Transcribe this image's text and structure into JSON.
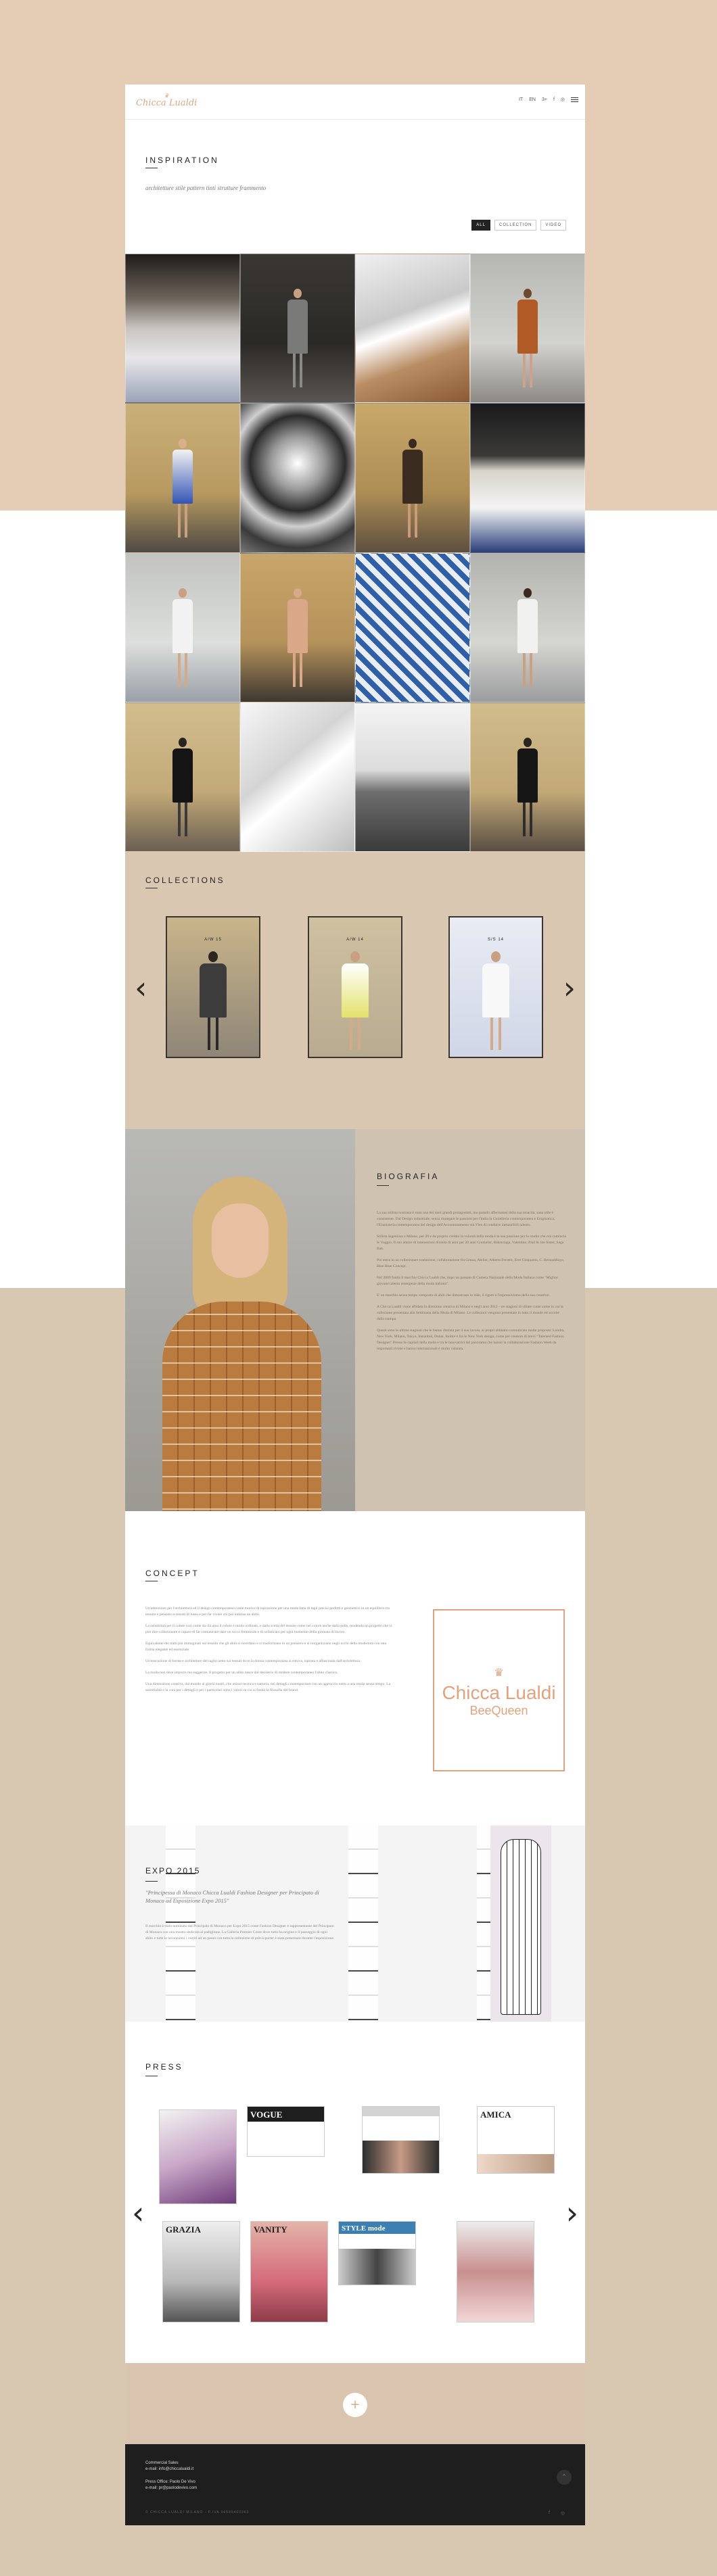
{
  "header": {
    "logo": "Chicca Lualdi",
    "nav": [
      "IT",
      "EN",
      "3+",
      "f",
      "◎"
    ]
  },
  "inspiration": {
    "title": "INSPIRATION",
    "subtitle": "architetture stile pattern tinti strutture frammento",
    "filters": [
      "ALL",
      "COLLECTION",
      "VIDEO"
    ]
  },
  "collections": {
    "title": "COLLECTIONS",
    "items": [
      "A/W 15",
      "A/W 14",
      "S/S 14"
    ]
  },
  "biografia": {
    "title": "BIOGRAFIA",
    "paragraphs": [
      "La sua stilista nostrana è stata una dei tanti grandi protagonisti, ma quando affermatasi della sua tenacità, sano stile è consistente. Dal Design industriale, senza rinnegare le passioni per l'Italia la Gioielleria contemporanea e Enigmatica, l'Ebanisteria contemporanea del design dell'Accontonamento sui Vien di condurre inesauribili talento.",
      "Stilista Ingeniosa a Milano, per 20 e da proprio credito la volontà della moda è la sua passione per lo studio che ora comincia le Vuggio. Il suo amore di intersezioni diventa di anni per 20 anni Couturier, Balenciaga, Valentino, Paul & Joe Sister, Saga Bak.",
      "Poi entra in un collezionare traduzione, collaborazione fra Genoa, Atelier, Alberta Ferretti, Erre Cinquanta, C. Benzaddiaye, Blue Blue Concept.",
      "Nel 2009 fonda il marchio Chicca Lualdi che, dopo un passato di Camera Nazionale della Moda Italiana come \"Miglior giovane talento emergente della moda italiana\".",
      "E' un marchio senza tempo composto di abiti che dimostrano lo stile, il rigore e l'espressivismo della sua creatrice.",
      "A Chicca Lualdi viene affidata la direzione creativa di Milano e negli anni 2012 - tre stagioni di sfilate come come in cui la collezione presentata alla Settimana della Moda di Milano. Le collezioni vengono presentate in tutto il mondo ed accolte dalla stampa.",
      "Questi sono le ultime stagioni che le hanno distinta per il suo lavoro, ai propri abbiamo comunicato molte proposte: Londra, New York, Milano, Tokyo, Instanbul, Dubai. Inoltre è fra le New York design, come per creatore di brevi \"Talented Fashion Designer\" Presso le capitali della moda e tra le innovatrici del panorama che hanno la collaborazione Fashion Week da importanti riviste e hanno internazionali è molto valutata."
    ]
  },
  "concept": {
    "title": "CONCEPT",
    "paragraphs": [
      "Un'attenzione per l'architettura ed il design contemporaneo come motivo di ispirazione per una moda fatta di tagli precisi perfetti e geometrici in un equilibrio tra tessuto e pensiero e tessuti di lusso e per far vivere chi poi indossa un abito.",
      "La sensibilità per il colore così come da chi ama il colore è molto ordinato, e dalla scelta del tessuto come nel colore anche dalla pelle, rendendo un progetto che si può dire collezionare e capace di far comunicare dare un tocco femminile e di sofisticato per ogni momento della giornata di lavoro.",
      "Equivalente dei tratti più immaginati sul tessuto che gli abiti si ricordano e si trasformano in un pensiero e si riorganizzano negli occhi della modernità con una forma elegante ed essenziale.",
      "Un'esecuzione di forme e architetture del taglio netto sui tessuti dove la donna contemporanea si ritrova, ispirata e affascinata dall'architettura.",
      "La moda non deve imporre ma suggerire. Il progetto per un abito nasce dal desiderio di rendere contemporaneo l'abito classico.",
      "Una dimensione creativa, dal mondo ai giorni nostri, che unisce tecnica e sartoria, nei dettagli contemporanei con un approccio netto a una moda senza tempo. La sartorialità e la cura per i dettagli e per i particolari sono i valori su cui si fonda la filosofia del brand."
    ],
    "brand_name": "Chicca Lualdi",
    "brand_sub": "BeeQueen",
    "bee": "♛"
  },
  "expo": {
    "title": "EXPO 2015",
    "lead": "\"Principessa di Monaco Chicca Lualdi Fashion Designer per Principato di Monaco ad Esposizione Expo 2015\"",
    "body": "Il marchio è stato nominato dal Principato di Monaco per Expo 2015 come Fashion Designer e rappresentante del Principato di Monaco con una mostra dedicata al padiglione. La Galleria Premier Conte dove tutto ha origine e il passaggio di ogni abito e tutte le lavorazioni i vestiti ad un passo con tutta la collezione di prêt-à-porter è stata presentata durante l'esposizione."
  },
  "press": {
    "title": "PRESS",
    "mags": [
      "",
      "VOGUE",
      "",
      "AMICA",
      "GRAZIA",
      "VANITY",
      "STYLE mode",
      ""
    ]
  },
  "footer": {
    "commercial_label": "Commercial Sales",
    "commercial_email": "e-mail: info@chiccalualdi.it",
    "press_label": "Press Office: Paolo De Vivo",
    "press_email": "e-mail: pr@paolodevivo.com",
    "copyright": "© CHICCA LUALDI MILANO - P.IVA 06589460963",
    "social": [
      "f",
      "◎"
    ],
    "up": "⌃"
  },
  "colors": {
    "accent": "#d9a982",
    "beige": "#d9c7b1",
    "dark": "#1e1e1e"
  }
}
